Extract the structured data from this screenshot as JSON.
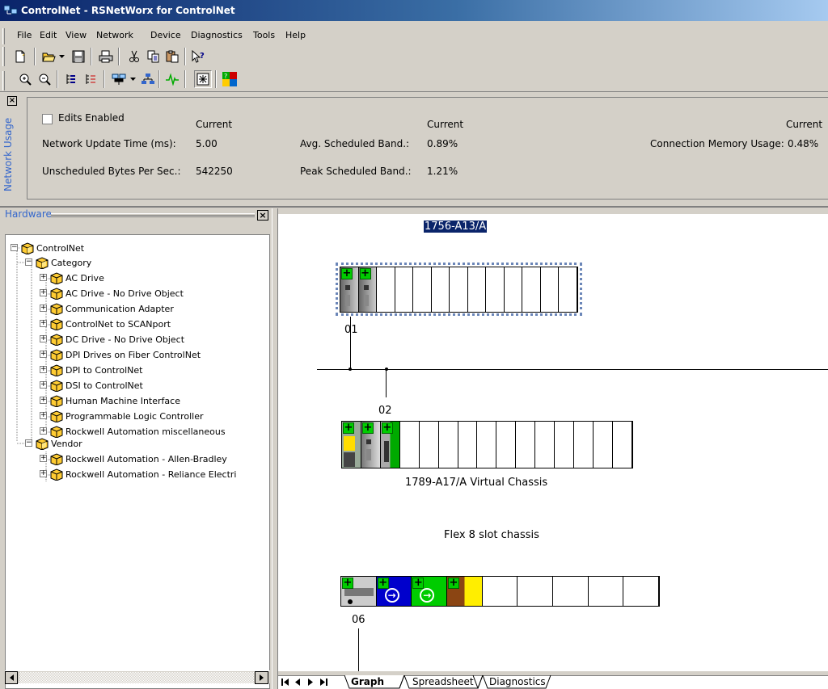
{
  "window": {
    "title": "ControlNet - RSNetWorx for ControlNet"
  },
  "menu": [
    "File",
    "Edit",
    "View",
    "Network",
    "Device",
    "Diagnostics",
    "Tools",
    "Help"
  ],
  "toolbar1_icons": [
    "new-icon",
    "open-icon",
    "dropdown-icon",
    "save-icon",
    "print-icon",
    "cut-icon",
    "copy-icon",
    "paste-icon",
    "help-pointer-icon"
  ],
  "toolbar2_icons": [
    "zoom-in-icon",
    "zoom-out-icon",
    "single-pass-browse-icon",
    "tree-icon",
    "online-icon",
    "dropdown-icon",
    "network-icon",
    "diagnostics-icon",
    "properties-icon",
    "controlnet-icon"
  ],
  "usage": {
    "panel_title": "Network Usage",
    "edits_enabled": "Edits Enabled",
    "current_header": "Current",
    "rows": [
      {
        "label": "Network Update Time (ms):",
        "value": "5.00"
      },
      {
        "label": "Unscheduled Bytes Per Sec.:",
        "value": "542250"
      }
    ],
    "mid_rows": [
      {
        "label": "Avg. Scheduled Band.:",
        "value": "0.89%"
      },
      {
        "label": "Peak Scheduled Band.:",
        "value": "1.21%"
      }
    ],
    "right_rows": [
      {
        "label": "Connection Memory Usage:",
        "value": "0.48%"
      }
    ]
  },
  "hardware": {
    "title": "Hardware",
    "root": "ControlNet",
    "category_label": "Category",
    "categories": [
      "AC Drive",
      "AC Drive - No Drive Object",
      "Communication Adapter",
      "ControlNet to SCANport",
      "DC Drive - No Drive Object",
      "DPI Drives on Fiber ControlNet",
      "DPI to ControlNet",
      "DSI to ControlNet",
      "Human Machine Interface",
      "Programmable Logic Controller",
      "Rockwell Automation miscellaneous"
    ],
    "vendor_label": "Vendor",
    "vendors": [
      "Rockwell Automation - Allen-Bradley",
      "Rockwell Automation - Reliance Electri"
    ]
  },
  "graph": {
    "selected_label": "1756-A13/A",
    "node1": "01",
    "node2": "02",
    "node3": "06",
    "chassis2_label": "1789-A17/A Virtual Chassis",
    "chassis3_label": "Flex 8 slot chassis"
  },
  "tabs": [
    "Graph",
    "Spreadsheet",
    "Diagnostics"
  ],
  "colors": {
    "title_start": "#0a246a",
    "title_end": "#a6caf0",
    "selection": "#0a246a",
    "panel": "#d4d0c8"
  }
}
